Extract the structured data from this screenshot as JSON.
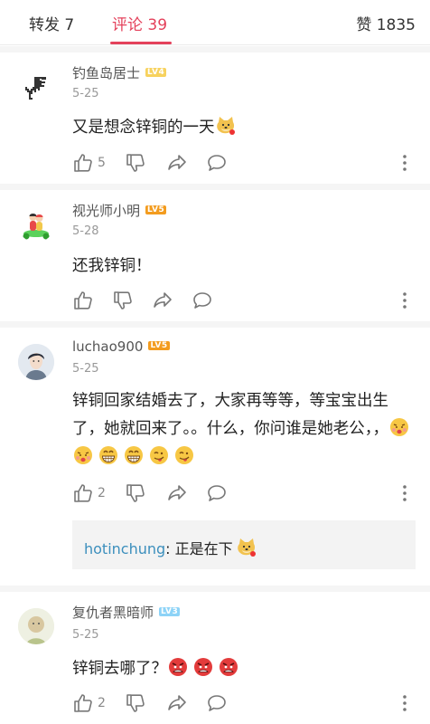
{
  "tabs": {
    "repost": "转发 7",
    "comments": "评论 39",
    "likes": "赞 1835"
  },
  "comments": [
    {
      "username": "钓鱼岛居士",
      "level": "LV4",
      "date": "5-25",
      "content": "又是想念锌铜的一天",
      "like_count": "5",
      "emojis": [
        "doge-emoji"
      ]
    },
    {
      "username": "视光师小明",
      "level": "LV5",
      "date": "5-28",
      "content": "还我锌铜！",
      "like_count": "",
      "emojis": []
    },
    {
      "username": "luchao900",
      "level": "LV5",
      "date": "5-25",
      "content": "锌铜回家结婚去了，大家再等等，等宝宝出生了，她就回来了。。什么，你问谁是她老公，，",
      "like_count": "2",
      "emojis": [
        "kiss-emoji",
        "kiss-emoji",
        "grin-emoji",
        "grin-emoji",
        "tongue-emoji",
        "tongue-emoji"
      ],
      "reply": {
        "user": "hotinchung",
        "text": ": 正是在下"
      }
    },
    {
      "username": "复仇者黑暗师",
      "level": "LV3",
      "date": "5-25",
      "content": "锌铜去哪了？",
      "like_count": "2",
      "emojis": [
        "angry-emoji",
        "angry-emoji",
        "angry-emoji"
      ]
    }
  ],
  "colors": {
    "accent": "#e4415b",
    "reply_user": "#3c8fbd",
    "lv4": "#f7d25e",
    "lv5": "#f39c1f",
    "lv3": "#8dd3f7"
  }
}
